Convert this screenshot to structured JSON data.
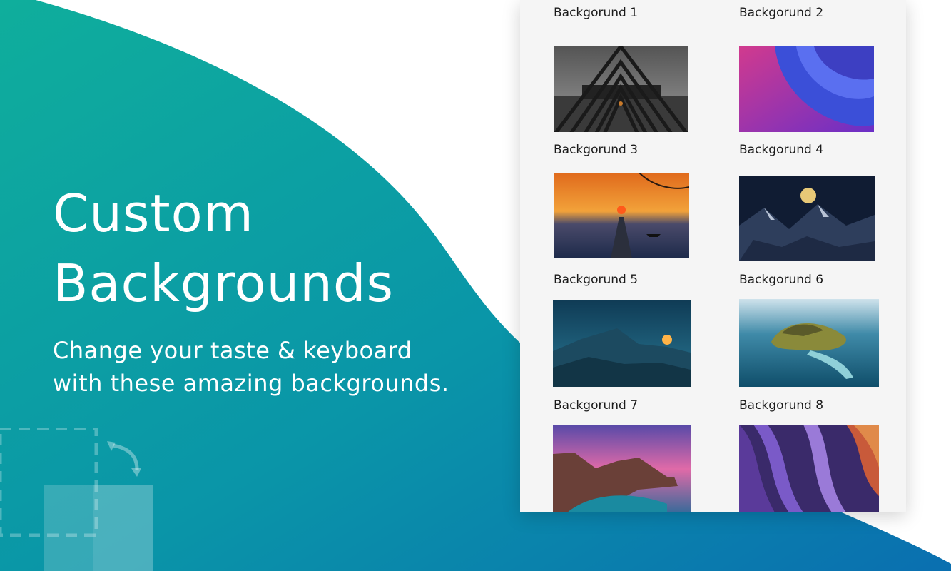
{
  "promo": {
    "title_line1": "Custom",
    "title_line2": "Backgrounds",
    "subtitle_line1": "Change your taste & keyboard",
    "subtitle_line2": "with these amazing backgrounds."
  },
  "colors": {
    "gradient_start": "#0fae9c",
    "gradient_end": "#0a6fb0",
    "panel": "#f5f5f5",
    "text_light": "#ffffff"
  },
  "gallery": {
    "items": [
      {
        "label": "Backgorund 1",
        "scene": "dark-triangle-tunnel"
      },
      {
        "label": "Backgorund 2",
        "scene": "abstract-purple-curves"
      },
      {
        "label": "Backgorund 3",
        "scene": "sunset-over-lake-with-pier"
      },
      {
        "label": "Backgorund 4",
        "scene": "moon-over-snowy-mountains"
      },
      {
        "label": "Backgorund 5",
        "scene": "night-mountain-sunrise"
      },
      {
        "label": "Backgorund 6",
        "scene": "aerial-tropical-island"
      },
      {
        "label": "Backgorund 7",
        "scene": "pink-sky-coastal-arch"
      },
      {
        "label": "Backgorund 8",
        "scene": "purple-canyon-waves"
      }
    ]
  },
  "icons": {
    "decoration": "resize-arrow-icon"
  }
}
